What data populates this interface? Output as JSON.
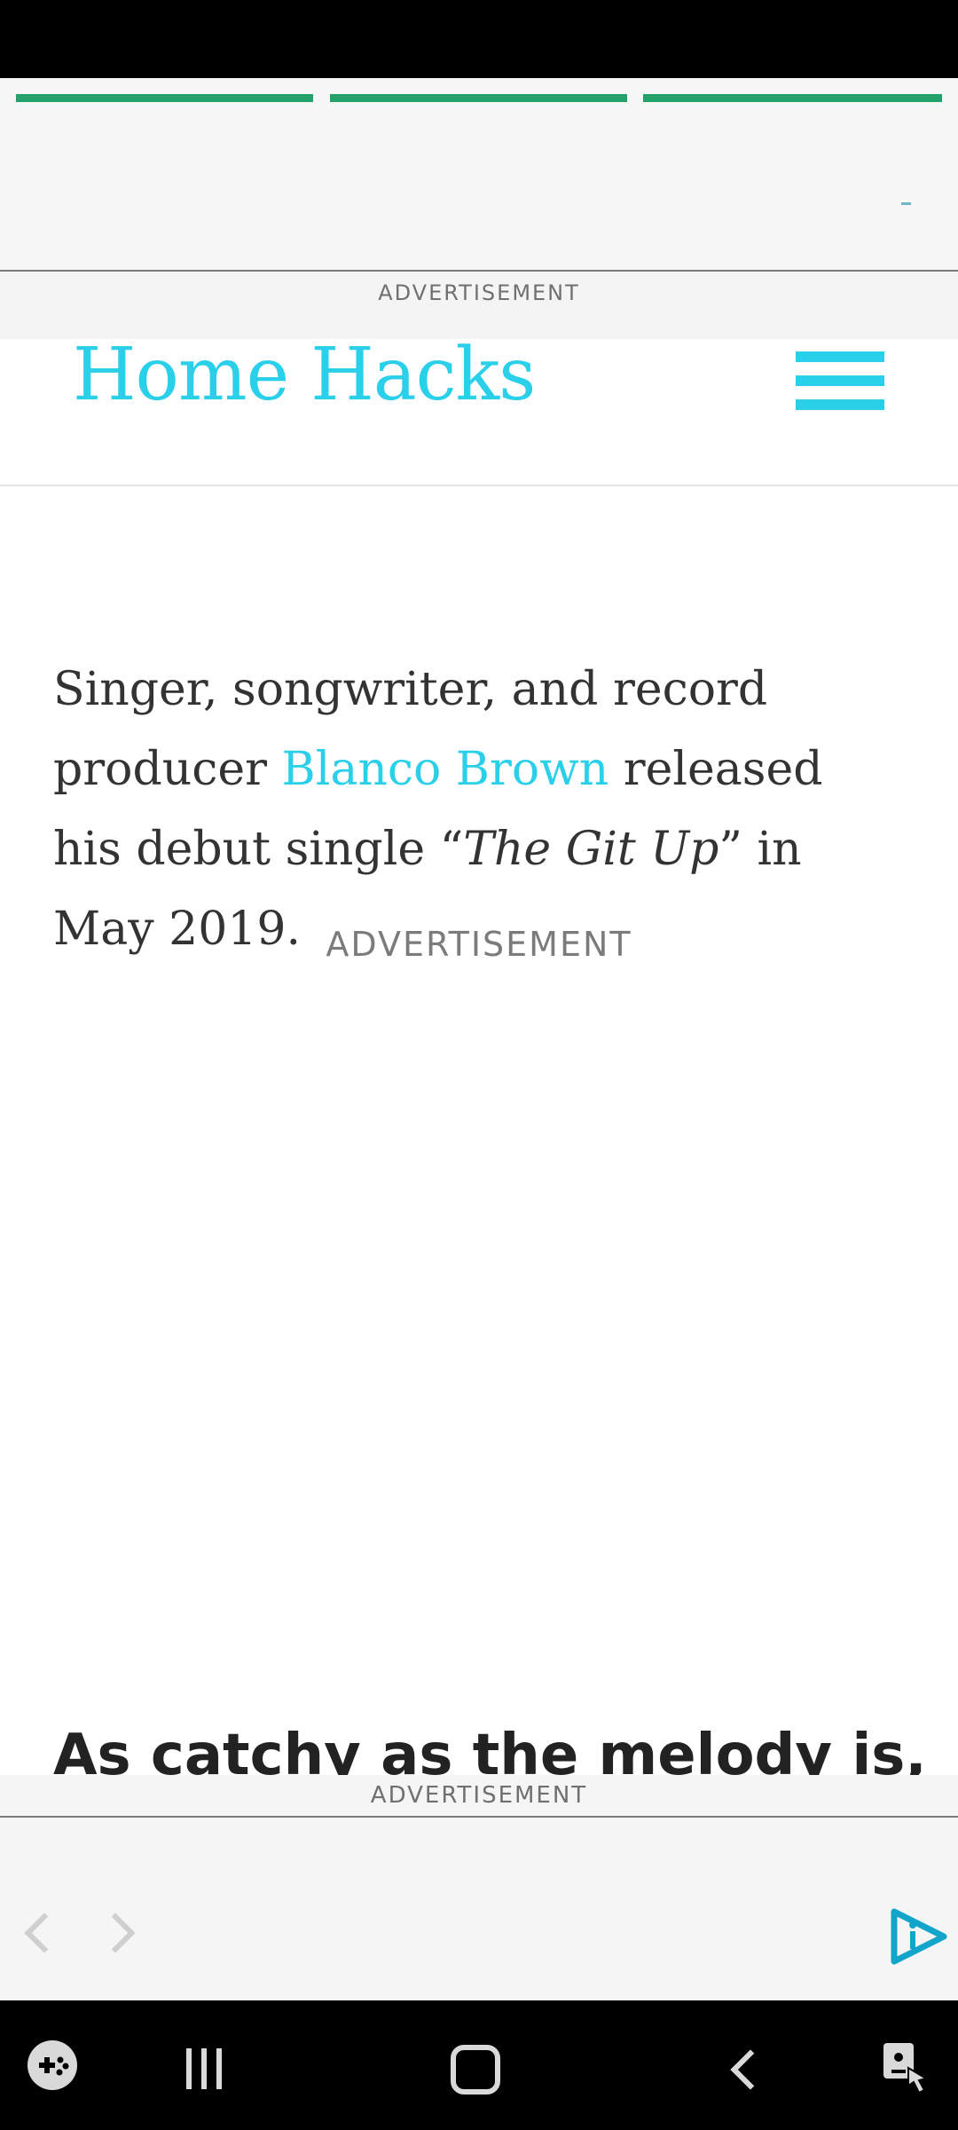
{
  "top_ad": {
    "progress_segments": 3,
    "label": "ADVERTISEMENT"
  },
  "header": {
    "logo": "Home Hacks",
    "menu_icon": "hamburger-menu-icon",
    "accent_color": "#2ad0ea"
  },
  "article": {
    "paragraph": {
      "part1": "Singer, songwriter, and record producer ",
      "link": "Blanco Brown",
      "part2": " released his debut single “",
      "italic": "The Git Up",
      "part3": "” in May 2019."
    },
    "ad_label": "ADVERTISEMENT",
    "next_heading": "As catchy as the melody is, it’s"
  },
  "bottom_ad": {
    "label": "ADVERTISEMENT",
    "prev_icon": "chevron-left-icon",
    "next_icon": "chevron-right-icon",
    "brand_icon": "ad-choices-play-icon"
  },
  "nav_bar": {
    "icons": [
      "game-launcher-icon",
      "recent-apps-icon",
      "home-icon",
      "back-icon",
      "accessibility-icon"
    ]
  }
}
